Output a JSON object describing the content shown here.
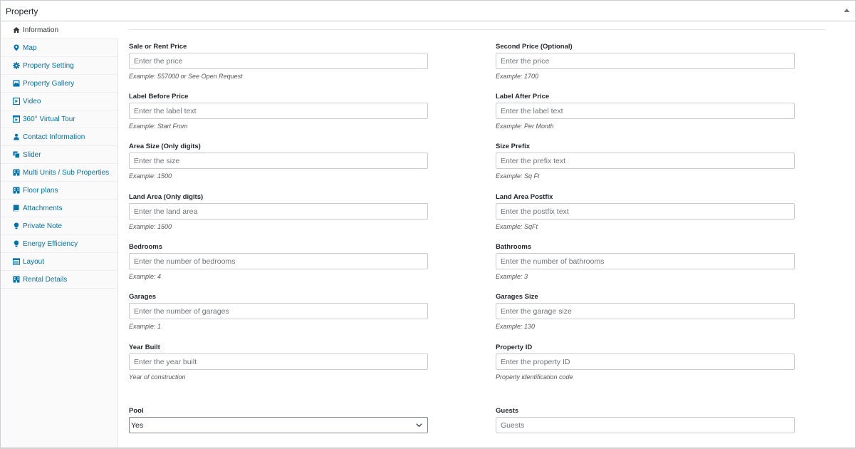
{
  "panel": {
    "title": "Property"
  },
  "sidebar": {
    "items": [
      {
        "label": "Information",
        "icon": "home-icon",
        "active": true
      },
      {
        "label": "Map",
        "icon": "map-marker-icon"
      },
      {
        "label": "Property Setting",
        "icon": "gear-icon"
      },
      {
        "label": "Property Gallery",
        "icon": "gallery-icon"
      },
      {
        "label": "Video",
        "icon": "video-icon"
      },
      {
        "label": "360° Virtual Tour",
        "icon": "virtual-tour-icon"
      },
      {
        "label": "Contact Information",
        "icon": "user-icon"
      },
      {
        "label": "Slider",
        "icon": "slider-icon"
      },
      {
        "label": "Multi Units / Sub Properties",
        "icon": "building-icon"
      },
      {
        "label": "Floor plans",
        "icon": "floor-plan-icon"
      },
      {
        "label": "Attachments",
        "icon": "book-icon"
      },
      {
        "label": "Private Note",
        "icon": "lightbulb-icon"
      },
      {
        "label": "Energy Efficiency",
        "icon": "lightbulb-icon"
      },
      {
        "label": "Layout",
        "icon": "layout-icon"
      },
      {
        "label": "Rental Details",
        "icon": "building-icon"
      }
    ]
  },
  "fields": {
    "sale_price": {
      "label": "Sale or Rent Price",
      "placeholder": "Enter the price",
      "desc": "Example: 557000 or See Open Request"
    },
    "second_price": {
      "label": "Second Price (Optional)",
      "placeholder": "Enter the price",
      "desc": "Example: 1700"
    },
    "label_before": {
      "label": "Label Before Price",
      "placeholder": "Enter the label text",
      "desc": "Example: Start From"
    },
    "label_after": {
      "label": "Label After Price",
      "placeholder": "Enter the label text",
      "desc": "Example: Per Month"
    },
    "area_size": {
      "label": "Area Size (Only digits)",
      "placeholder": "Enter the size",
      "desc": "Example: 1500"
    },
    "size_prefix": {
      "label": "Size Prefix",
      "placeholder": "Enter the prefix text",
      "desc": "Example: Sq Ft"
    },
    "land_area": {
      "label": "Land Area (Only digits)",
      "placeholder": "Enter the land area",
      "desc": "Example: 1500"
    },
    "land_postfix": {
      "label": "Land Area Postfix",
      "placeholder": "Enter the postfix text",
      "desc": "Example: SqFt"
    },
    "bedrooms": {
      "label": "Bedrooms",
      "placeholder": "Enter the number of bedrooms",
      "desc": "Example: 4"
    },
    "bathrooms": {
      "label": "Bathrooms",
      "placeholder": "Enter the number of bathrooms",
      "desc": "Example: 3"
    },
    "garages": {
      "label": "Garages",
      "placeholder": "Enter the number of garages",
      "desc": "Example: 1"
    },
    "garages_size": {
      "label": "Garages Size",
      "placeholder": "Enter the garage size",
      "desc": "Example: 130"
    },
    "year_built": {
      "label": "Year Built",
      "placeholder": "Enter the year built",
      "desc": "Year of construction"
    },
    "property_id": {
      "label": "Property ID",
      "placeholder": "Enter the property ID",
      "desc": "Property identification code"
    },
    "pool": {
      "label": "Pool",
      "value": "Yes"
    },
    "guests": {
      "label": "Guests",
      "placeholder": "Guests"
    }
  }
}
